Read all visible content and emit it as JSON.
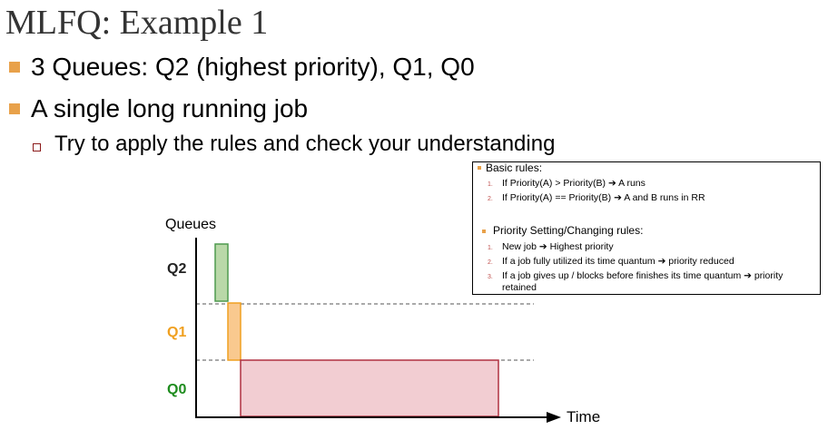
{
  "title": "MLFQ: Example 1",
  "bullets": [
    "3 Queues: Q2 (highest priority), Q1, Q0",
    "A single long running job"
  ],
  "sub_bullets": [
    "Try to apply the rules and check your understanding"
  ],
  "rules_box": {
    "basic_header": "Basic rules:",
    "basic": [
      {
        "num": "1.",
        "text": "If Priority(A) > Priority(B) ➔ A runs"
      },
      {
        "num": "2.",
        "text": "If Priority(A) == Priority(B) ➔ A and B runs in RR"
      }
    ],
    "priority_header": "Priority Setting/Changing rules:",
    "priority": [
      {
        "num": "1.",
        "text": "New job ➔ Highest priority"
      },
      {
        "num": "2.",
        "text": "If a job fully utilized its time quantum ➔ priority reduced"
      },
      {
        "num": "3.",
        "text": "If a job gives up / blocks before finishes its time quantum ➔ priority",
        "cont": "retained"
      }
    ]
  },
  "diagram": {
    "ylabel": "Queues",
    "xlabel": "Time",
    "queues": [
      {
        "name": "Q2",
        "color": "#222222"
      },
      {
        "name": "Q1",
        "color": "#f0a020"
      },
      {
        "name": "Q0",
        "color": "#1e8c1e"
      }
    ],
    "colors": {
      "q2_fill": "#b9d8a8",
      "q2_stroke": "#4e9a4e",
      "q1_fill": "#f9c98f",
      "q1_stroke": "#f0a020",
      "q0_fill": "#f2cdd2",
      "q0_stroke": "#b03040",
      "bullet": "#e8a14a"
    }
  }
}
